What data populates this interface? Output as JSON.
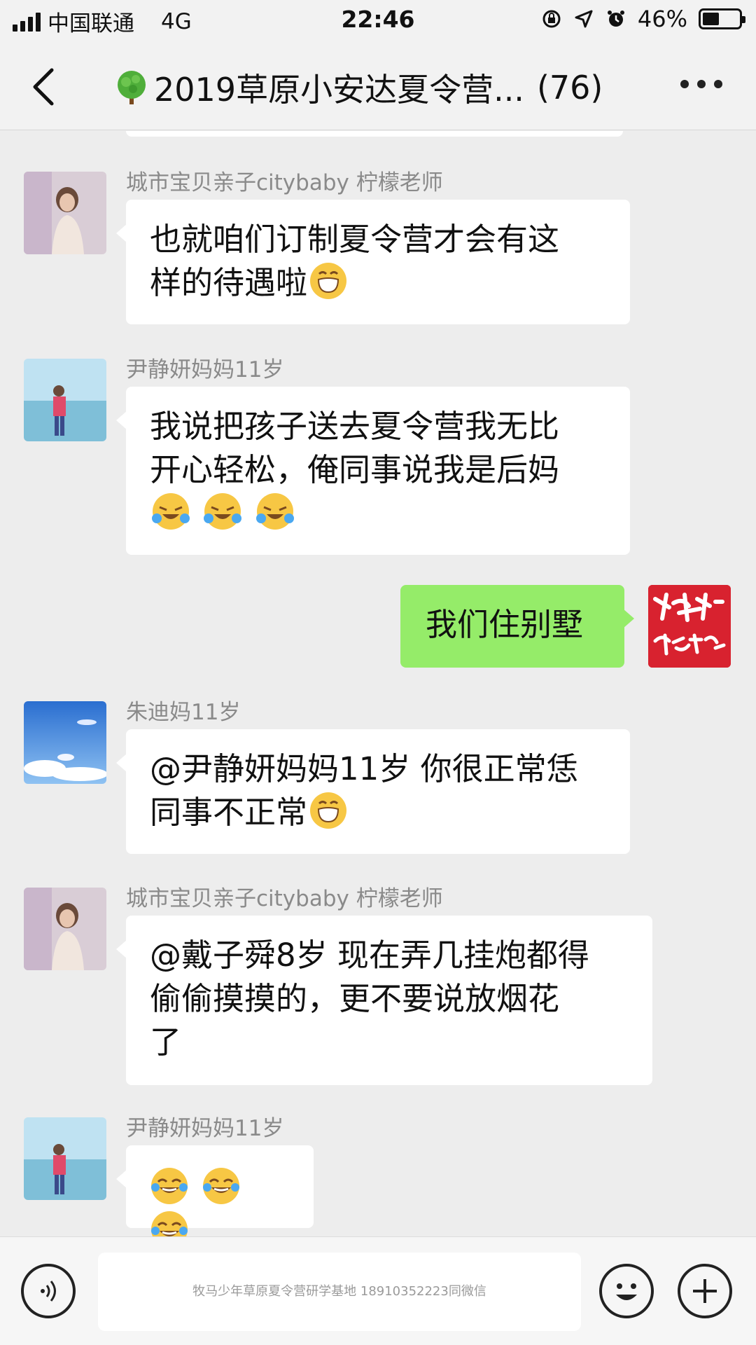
{
  "status_bar": {
    "carrier": "中国联通",
    "network": "4G",
    "time": "22:46",
    "battery_percent": "46%",
    "battery_level": 0.46
  },
  "nav": {
    "title": "2019草原小安达夏令营...",
    "member_count": "(76)"
  },
  "messages": [
    {
      "sender": "城市宝贝亲子citybaby 柠檬老师",
      "lines": [
        "也就咱们订制夏令营才会有这",
        "样的待遇啦"
      ]
    },
    {
      "sender": "尹静妍妈妈11岁",
      "lines": [
        "我说把孩子送去夏令营我无比",
        "开心轻松，俺同事说我是后妈"
      ]
    },
    {
      "sender": "",
      "self": true,
      "text": "我们住别墅",
      "avatar_text": "坚持 做最好的自己"
    },
    {
      "sender": "朱迪妈11岁",
      "lines": [
        "@尹静妍妈妈11岁 你很正常恁",
        "同事不正常"
      ]
    },
    {
      "sender": "城市宝贝亲子citybaby 柠檬老师",
      "lines": [
        "@戴子舜8岁 现在弄几挂炮都得",
        "偷偷摸摸的，更不要说放烟花",
        "了"
      ]
    },
    {
      "sender": "尹静妍妈妈11岁",
      "lines": []
    }
  ],
  "input_bar": {
    "placeholder": "牧马少年草原夏令营研学基地 18910352223同微信"
  },
  "colors": {
    "self_bubble": "#95ec69",
    "background": "#ededed"
  }
}
